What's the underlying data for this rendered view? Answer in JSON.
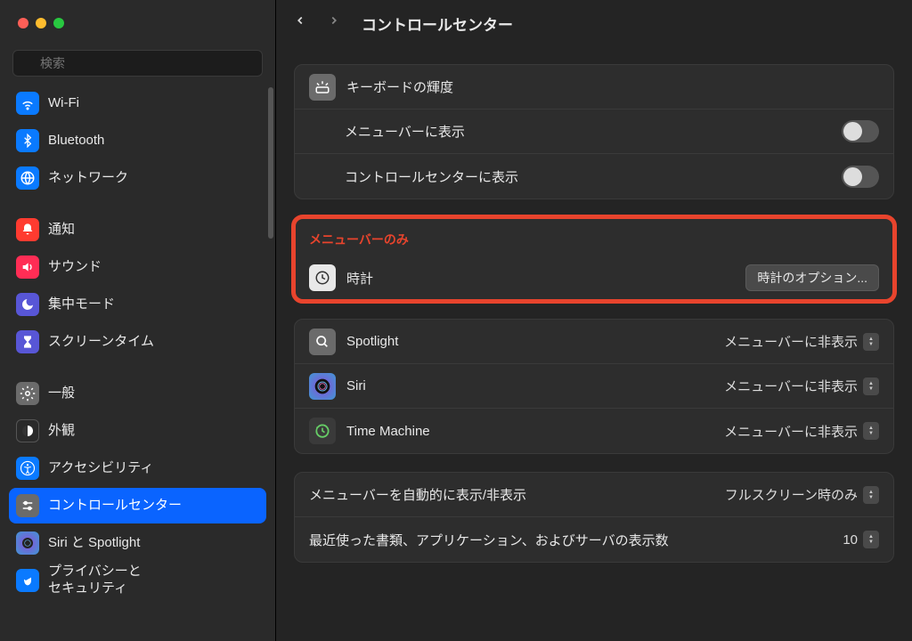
{
  "search": {
    "placeholder": "検索"
  },
  "header": {
    "title": "コントロールセンター"
  },
  "sidebar": {
    "items": [
      {
        "label": "Wi-Fi",
        "icon": "wifi",
        "bg": "bg-blue"
      },
      {
        "label": "Bluetooth",
        "icon": "bt",
        "bg": "bg-blue"
      },
      {
        "label": "ネットワーク",
        "icon": "globe",
        "bg": "bg-blue"
      },
      {
        "label": "通知",
        "icon": "bell",
        "bg": "bg-red"
      },
      {
        "label": "サウンド",
        "icon": "speaker",
        "bg": "bg-red-dark"
      },
      {
        "label": "集中モード",
        "icon": "moon",
        "bg": "bg-purple"
      },
      {
        "label": "スクリーンタイム",
        "icon": "hourglass",
        "bg": "bg-hourglass"
      },
      {
        "label": "一般",
        "icon": "gear",
        "bg": "bg-gray"
      },
      {
        "label": "外観",
        "icon": "appearance",
        "bg": "bg-dark"
      },
      {
        "label": "アクセシビリティ",
        "icon": "a11y",
        "bg": "bg-blue"
      },
      {
        "label": "コントロールセンター",
        "icon": "cc",
        "bg": "bg-gray"
      },
      {
        "label": "Siri と Spotlight",
        "icon": "siri",
        "bg": "bg-siri"
      },
      {
        "label": "プライバシーと\nセキュリティ",
        "icon": "hand",
        "bg": "bg-blue"
      }
    ]
  },
  "section1": {
    "title": "キーボードの輝度",
    "rows": [
      {
        "label": "メニューバーに表示"
      },
      {
        "label": "コントロールセンターに表示"
      }
    ]
  },
  "section2": {
    "header": "メニューバーのみ",
    "row_clock": {
      "label": "時計",
      "button": "時計のオプション..."
    }
  },
  "section3": {
    "rows": [
      {
        "label": "Spotlight",
        "value": "メニューバーに非表示"
      },
      {
        "label": "Siri",
        "value": "メニューバーに非表示"
      },
      {
        "label": "Time Machine",
        "value": "メニューバーに非表示"
      }
    ]
  },
  "section4": {
    "rows": [
      {
        "label": "メニューバーを自動的に表示/非表示",
        "value": "フルスクリーン時のみ"
      },
      {
        "label": "最近使った書類、アプリケーション、およびサーバの表示数",
        "value": "10"
      }
    ]
  }
}
